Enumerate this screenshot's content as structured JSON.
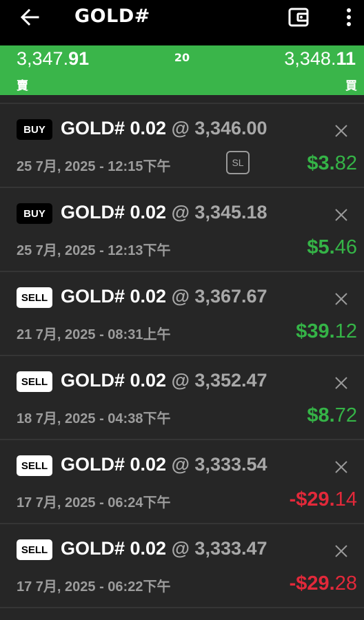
{
  "header": {
    "title": "GOLD#"
  },
  "quote": {
    "sell_main": "3,347.",
    "sell_big": "91",
    "spread": "20",
    "buy_main": "3,348.",
    "buy_big": "11",
    "sell_label": "賣",
    "buy_label": "買"
  },
  "colors": {
    "profit": "#35b447",
    "loss": "#e2293a",
    "quote_bar": "#3ab54a"
  },
  "orders": [
    {
      "side": "BUY",
      "symbol": "GOLD# 0.02",
      "at": "@",
      "price": "3,346.00",
      "time": "25 7月, 2025 - 12:15下午",
      "sl": "SL",
      "pnl_int": "$3.",
      "pnl_dec": "82"
    },
    {
      "side": "BUY",
      "symbol": "GOLD# 0.02",
      "at": "@",
      "price": "3,345.18",
      "time": "25 7月, 2025 - 12:13下午",
      "pnl_int": "$5.",
      "pnl_dec": "46"
    },
    {
      "side": "SELL",
      "symbol": "GOLD# 0.02",
      "at": "@",
      "price": "3,367.67",
      "time": "21 7月, 2025 - 08:31上午",
      "pnl_int": "$39.",
      "pnl_dec": "12"
    },
    {
      "side": "SELL",
      "symbol": "GOLD# 0.02",
      "at": "@",
      "price": "3,352.47",
      "time": "18 7月, 2025 - 04:38下午",
      "pnl_int": "$8.",
      "pnl_dec": "72"
    },
    {
      "side": "SELL",
      "symbol": "GOLD# 0.02",
      "at": "@",
      "price": "3,333.54",
      "time": "17 7月, 2025 - 06:24下午",
      "pnl_int": "-$29.",
      "pnl_dec": "14"
    },
    {
      "side": "SELL",
      "symbol": "GOLD# 0.02",
      "at": "@",
      "price": "3,333.47",
      "time": "17 7月, 2025 - 06:22下午",
      "pnl_int": "-$29.",
      "pnl_dec": "28"
    }
  ]
}
